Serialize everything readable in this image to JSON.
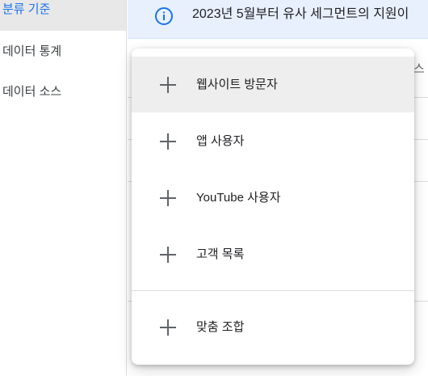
{
  "sidebar": {
    "items": [
      {
        "label": "분류 기준",
        "active": true
      },
      {
        "label": "데이터 통계",
        "active": false
      },
      {
        "label": "데이터 소스",
        "active": false
      }
    ]
  },
  "banner": {
    "icon": "info-icon",
    "text": "2023년 5월부터 유사 세그먼트의 지원이"
  },
  "background": {
    "partial_text": "스"
  },
  "menu": {
    "items": [
      {
        "icon": "plus-icon",
        "label": "웹사이트 방문자",
        "highlighted": true
      },
      {
        "icon": "plus-icon",
        "label": "앱 사용자"
      },
      {
        "icon": "plus-icon",
        "label": "YouTube 사용자"
      },
      {
        "icon": "plus-icon",
        "label": "고객 목록"
      },
      {
        "icon": "plus-icon",
        "label": "맞춤 조합"
      }
    ]
  },
  "colors": {
    "accent": "#1a73e8",
    "banner_bg": "#e8f0fe",
    "hover_bg": "#eeeeee",
    "icon_gray": "#5f6368"
  }
}
